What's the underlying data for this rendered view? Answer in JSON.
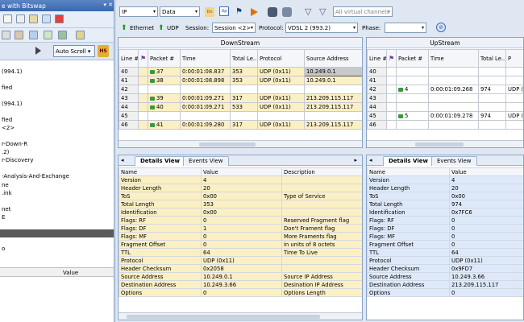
{
  "left_panel": {
    "title": "e with Bitswap",
    "auto_scroll_label": "Auto Scroll",
    "hs_label": "HS",
    "tree_lines": [
      "(994.1)",
      "fied",
      "(994.1)",
      "fied",
      "<2>",
      "r-Down-R",
      ".2)",
      "r-Discovery",
      "-Analysis-And-Exchange",
      "ne",
      ".ink",
      "net",
      "E",
      "o"
    ],
    "value_header": "Value"
  },
  "toolbar1": {
    "protocol_select": "IP",
    "data_select": "Data",
    "channels_placeholder": "All virtual channels"
  },
  "toolbar2": {
    "ethernet_label": "Ethernet",
    "udp_label": "UDP",
    "session_label": "Session:",
    "session_value": "Session <2>",
    "protocol_label": "Protocol:",
    "protocol_value": "VDSL 2 (993.2)",
    "phase_label": "Phase:",
    "phase_value": ""
  },
  "downstream": {
    "title": "DownStream",
    "columns": [
      "Line #",
      "",
      "Packet #",
      "Time",
      "Total Le...",
      "Protocol",
      "Source Address"
    ],
    "rows": [
      {
        "line": "40",
        "packet": "37",
        "time": "0:00:01:08.837",
        "len": "353",
        "proto": "UDP (0x11)",
        "src": "10.249.0.1",
        "style": "y",
        "sel": true
      },
      {
        "line": "41",
        "packet": "38",
        "time": "0:00:01:08.898",
        "len": "353",
        "proto": "UDP (0x11)",
        "src": "10.249.0.1",
        "style": "y"
      },
      {
        "line": "42",
        "packet": "",
        "time": "",
        "len": "",
        "proto": "",
        "src": "",
        "style": "w"
      },
      {
        "line": "43",
        "packet": "39",
        "time": "0:00:01:09.271",
        "len": "317",
        "proto": "UDP (0x11)",
        "src": "213.209.115.117",
        "style": "y"
      },
      {
        "line": "44",
        "packet": "40",
        "time": "0:00:01:09.271",
        "len": "533",
        "proto": "UDP (0x11)",
        "src": "213.209.115.117",
        "style": "y"
      },
      {
        "line": "45",
        "packet": "",
        "time": "",
        "len": "",
        "proto": "",
        "src": "",
        "style": "w"
      },
      {
        "line": "46",
        "packet": "41",
        "time": "0:00:01:09.280",
        "len": "317",
        "proto": "UDP (0x11)",
        "src": "213.209.115.117",
        "style": "y"
      }
    ]
  },
  "upstream": {
    "title": "UpStream",
    "columns": [
      "Line #",
      "",
      "Packet #",
      "Time",
      "Total Le...",
      "P"
    ],
    "rows": [
      {
        "line": "40",
        "packet": "",
        "time": "",
        "len": "",
        "proto": "",
        "style": "w"
      },
      {
        "line": "41",
        "packet": "",
        "time": "",
        "len": "",
        "proto": "",
        "style": "w"
      },
      {
        "line": "42",
        "packet": "4",
        "time": "0:00:01:09.268",
        "len": "974",
        "proto": "UDP (",
        "style": "b"
      },
      {
        "line": "43",
        "packet": "",
        "time": "",
        "len": "",
        "proto": "",
        "style": "w"
      },
      {
        "line": "44",
        "packet": "",
        "time": "",
        "len": "",
        "proto": "",
        "style": "w"
      },
      {
        "line": "45",
        "packet": "5",
        "time": "0:00:01:09.278",
        "len": "974",
        "proto": "UDP (",
        "style": "b"
      },
      {
        "line": "46",
        "packet": "",
        "time": "",
        "len": "",
        "proto": "",
        "style": "w"
      }
    ]
  },
  "details_left": {
    "tabs": [
      "Details View",
      "Events View"
    ],
    "columns": [
      "Name",
      "Value",
      "Description"
    ],
    "rows": [
      [
        "Version",
        "4",
        ""
      ],
      [
        "Header Length",
        "20",
        ""
      ],
      [
        "ToS",
        "0x00",
        "Type of Service"
      ],
      [
        "Total Length",
        "353",
        ""
      ],
      [
        "Identification",
        "0x00",
        ""
      ],
      [
        "Flags: RF",
        "0",
        "Reserved Fragment flag"
      ],
      [
        "Flags: DF",
        "1",
        "Don't Frament flag"
      ],
      [
        "Flags: MF",
        "0",
        "More Framents flag"
      ],
      [
        "Fragment Offset",
        "0",
        "in units of 8 octets"
      ],
      [
        "TTL",
        "64",
        "Time To Live"
      ],
      [
        "Protocol",
        "UDP (0x11)",
        ""
      ],
      [
        "Header Checksum",
        "0x2058",
        ""
      ],
      [
        "Source Address",
        "10.249.0.1",
        "Source IP Address"
      ],
      [
        "Destination Address",
        "10.249.3.66",
        "Desination IP Address"
      ],
      [
        "Options",
        "0",
        "Options Length"
      ]
    ]
  },
  "details_right": {
    "tabs": [
      "Details View",
      "Events View"
    ],
    "columns": [
      "Name",
      "Value"
    ],
    "rows": [
      [
        "Version",
        "4"
      ],
      [
        "Header Length",
        "20"
      ],
      [
        "ToS",
        "0x00"
      ],
      [
        "Total Length",
        "974"
      ],
      [
        "Identification",
        "0x7FC6"
      ],
      [
        "Flags: RF",
        "0"
      ],
      [
        "Flags: DF",
        "0"
      ],
      [
        "Flags: MF",
        "0"
      ],
      [
        "Fragment Offset",
        "0"
      ],
      [
        "TTL",
        "64"
      ],
      [
        "Protocol",
        "UDP (0x11)"
      ],
      [
        "Header Checksum",
        "0x9FD7"
      ],
      [
        "Source Address",
        "10.249.3.66"
      ],
      [
        "Destination Address",
        "213.209.115.117"
      ],
      [
        "Options",
        "0"
      ]
    ]
  },
  "icons": [
    "pin-icon",
    "close-icon",
    "play-icon",
    "hs-icon",
    "dn-icon",
    "up-icon",
    "flag-icon",
    "forward-icon",
    "binoculars-icon",
    "filter-icon",
    "ethernet-arrow-icon",
    "udp-arrow-icon",
    "settings-icon"
  ]
}
